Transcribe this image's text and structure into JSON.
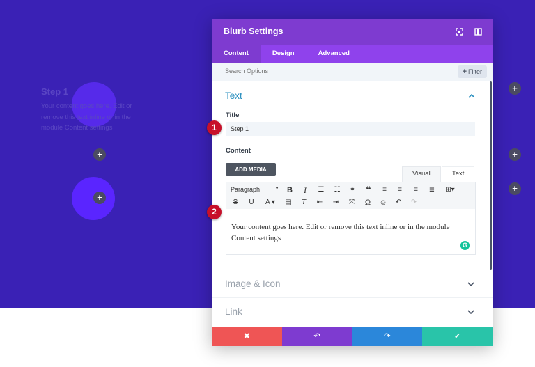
{
  "canvas": {
    "step_title": "Step 1",
    "step_text": "Your content goes here. Edit or remove this text inline or in the module Content settings",
    "plus_glyph": "+"
  },
  "modal": {
    "title": "Blurb Settings",
    "header_icons": [
      "expand-icon",
      "sidebar-toggle-icon"
    ],
    "tabs": [
      {
        "label": "Content",
        "active": true
      },
      {
        "label": "Design",
        "active": false
      },
      {
        "label": "Advanced",
        "active": false
      }
    ],
    "search": {
      "placeholder": "Search Options",
      "filter_label": "Filter"
    },
    "text_section": {
      "heading": "Text",
      "title_label": "Title",
      "title_value": "Step 1",
      "content_label": "Content",
      "add_media": "ADD MEDIA",
      "mode_visual": "Visual",
      "mode_text": "Text",
      "paragraph_select": "Paragraph",
      "editor_content": "Your content goes here. Edit or remove this text inline or in the module Content settings",
      "grammarly_glyph": "G"
    },
    "collapsed_sections": [
      "Image & Icon",
      "Link"
    ],
    "footer": {
      "cancel": "✖",
      "undo": "↶",
      "redo": "↷",
      "save": "✔"
    }
  },
  "annotations": [
    "1",
    "2"
  ],
  "colors": {
    "canvas_bg": "#3a21b5",
    "header": "#7e3bd0",
    "tabs": "#8f42ec",
    "accent_blue": "#2a8fbf",
    "cancel": "#ef5555",
    "undo": "#7e3bd0",
    "redo": "#2b87da",
    "save": "#29c4a9",
    "badge": "#c7102a"
  }
}
